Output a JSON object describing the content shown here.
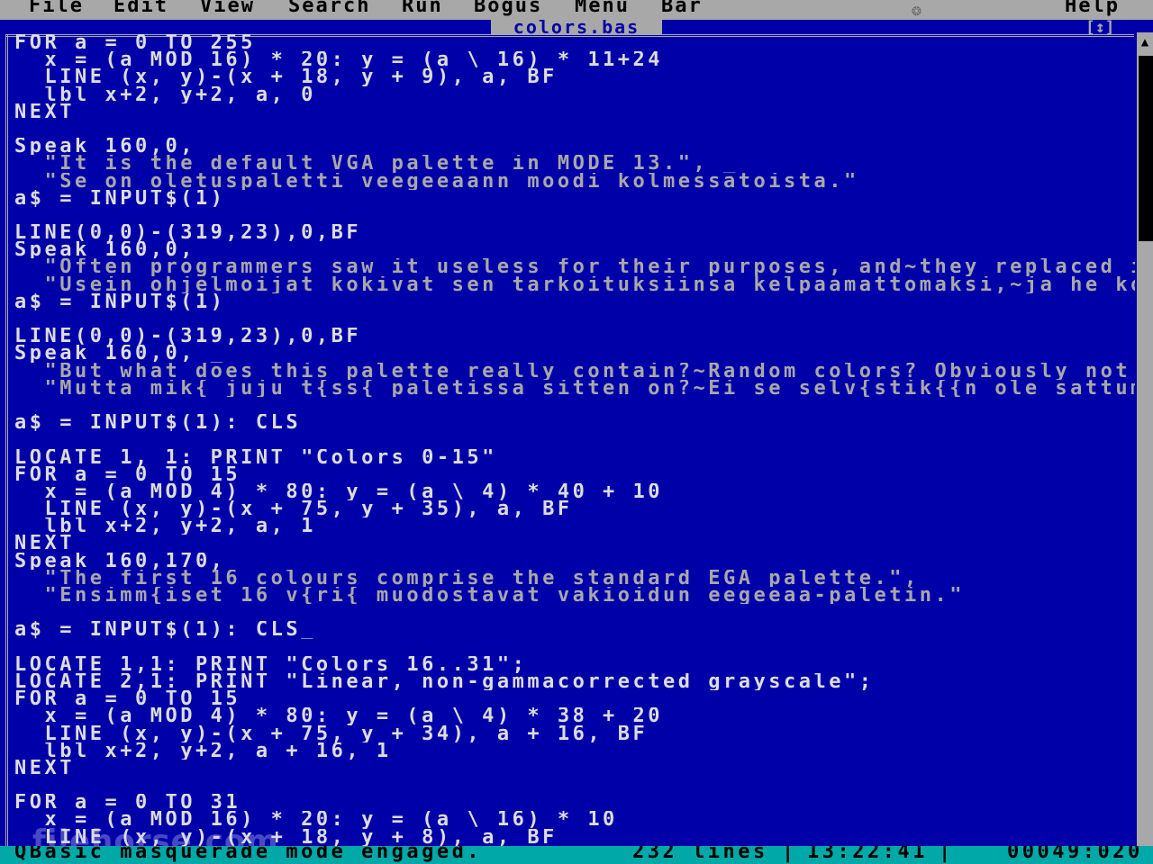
{
  "menu": [
    "File",
    "Edit",
    "View",
    "Search",
    "Run",
    "Bogus",
    "Menu",
    "Bar",
    "Help"
  ],
  "menu_icon": "paw-icon",
  "editor": {
    "filename": "colors.bas",
    "window_controls": "[↕]",
    "lines": [
      {
        "t": "FOR a = 0 TO 255",
        "s": false
      },
      {
        "t": "  x = (a MOD 16) * 20: y = (a \\ 16) * 11+24",
        "s": false
      },
      {
        "t": "  LINE (x, y)-(x + 18, y + 9), a, BF",
        "s": false
      },
      {
        "t": "  lbl x+2, y+2, a, 0",
        "s": false
      },
      {
        "t": "NEXT",
        "s": false
      },
      {
        "t": "",
        "s": false
      },
      {
        "t": "Speak 160,0, _",
        "s": false
      },
      {
        "t": "  \"It is the default VGA palette in MODE 13.\", _",
        "s": true
      },
      {
        "t": "  \"Se on oletuspaletti veegeeaann moodi kolmessatoista.\"",
        "s": true
      },
      {
        "t": "a$ = INPUT$(1)",
        "s": false
      },
      {
        "t": "",
        "s": false
      },
      {
        "t": "LINE(0,0)-(319,23),0,BF",
        "s": false
      },
      {
        "t": "Speak 160,0, _",
        "s": false
      },
      {
        "t": "  \"Often programmers saw it useless for their purposes, and~they replaced it w",
        "s": true
      },
      {
        "t": "  \"Usein ohjelmoijat kokivat sen tarkoituksiinsa kelpaamattomaksi,~ja he korva",
        "s": true
      },
      {
        "t": "a$ = INPUT$(1)",
        "s": false
      },
      {
        "t": "",
        "s": false
      },
      {
        "t": "LINE(0,0)-(319,23),0,BF",
        "s": false
      },
      {
        "t": "Speak 160,0, _",
        "s": false
      },
      {
        "t": "  \"But what does this palette really contain?~Random colors? Obviously not. Le",
        "s": true
      },
      {
        "t": "  \"Mutta mik{ juju t{ss{ paletissa sitten on?~Ei se selv{stik{{n ole sattumanv",
        "s": true
      },
      {
        "t": "",
        "s": false
      },
      {
        "t": "a$ = INPUT$(1): CLS",
        "s": false
      },
      {
        "t": "",
        "s": false
      },
      {
        "t": "LOCATE 1, 1: PRINT \"Colors 0-15\"",
        "s": false
      },
      {
        "t": "FOR a = 0 TO 15",
        "s": false
      },
      {
        "t": "  x = (a MOD 4) * 80: y = (a \\ 4) * 40 + 10",
        "s": false
      },
      {
        "t": "  LINE (x, y)-(x + 75, y + 35), a, BF",
        "s": false
      },
      {
        "t": "  lbl x+2, y+2, a, 1",
        "s": false
      },
      {
        "t": "NEXT",
        "s": false
      },
      {
        "t": "Speak 160,170, _",
        "s": false
      },
      {
        "t": "  \"The first 16 colours comprise the standard EGA palette.\", _",
        "s": true
      },
      {
        "t": "  \"Ensimm{iset 16 v{ri{ muodostavat vakioidun eegeeaa-paletin.\"",
        "s": true
      },
      {
        "t": "",
        "s": false
      },
      {
        "t": "a$ = INPUT$(1): CLS_",
        "s": false
      },
      {
        "t": "",
        "s": false
      },
      {
        "t": "LOCATE 1,1: PRINT \"Colors 16..31\";",
        "s": false
      },
      {
        "t": "LOCATE 2,1: PRINT \"Linear, non-gammacorrected grayscale\";",
        "s": false
      },
      {
        "t": "FOR a = 0 TO 15",
        "s": false
      },
      {
        "t": "  x = (a MOD 4) * 80: y = (a \\ 4) * 38 + 20",
        "s": false
      },
      {
        "t": "  LINE (x, y)-(x + 75, y + 34), a + 16, BF",
        "s": false
      },
      {
        "t": "  lbl x+2, y+2, a + 16, 1",
        "s": false
      },
      {
        "t": "NEXT",
        "s": false
      },
      {
        "t": "",
        "s": false
      },
      {
        "t": "FOR a = 0 TO 31",
        "s": false
      },
      {
        "t": "  x = (a MOD 16) * 20: y = (a \\ 16) * 10",
        "s": false
      },
      {
        "t": "  LINE (x, y)-(x + 18, y + 8), a, BF",
        "s": false
      }
    ]
  },
  "scrollbar": {
    "up_arrow": "▲"
  },
  "watermark": "filehorse.com",
  "status": {
    "message": "QBasic masquerade mode engaged.",
    "lines": "232 lines",
    "time": "13:22:41",
    "position": "00049:020",
    "separator": "|"
  },
  "colors": {
    "background": "#0000a8",
    "text": "#dcdcdc",
    "string": "#a8a8a8",
    "menubar": "#a8a8a8",
    "statusbar": "#00a8a8"
  }
}
